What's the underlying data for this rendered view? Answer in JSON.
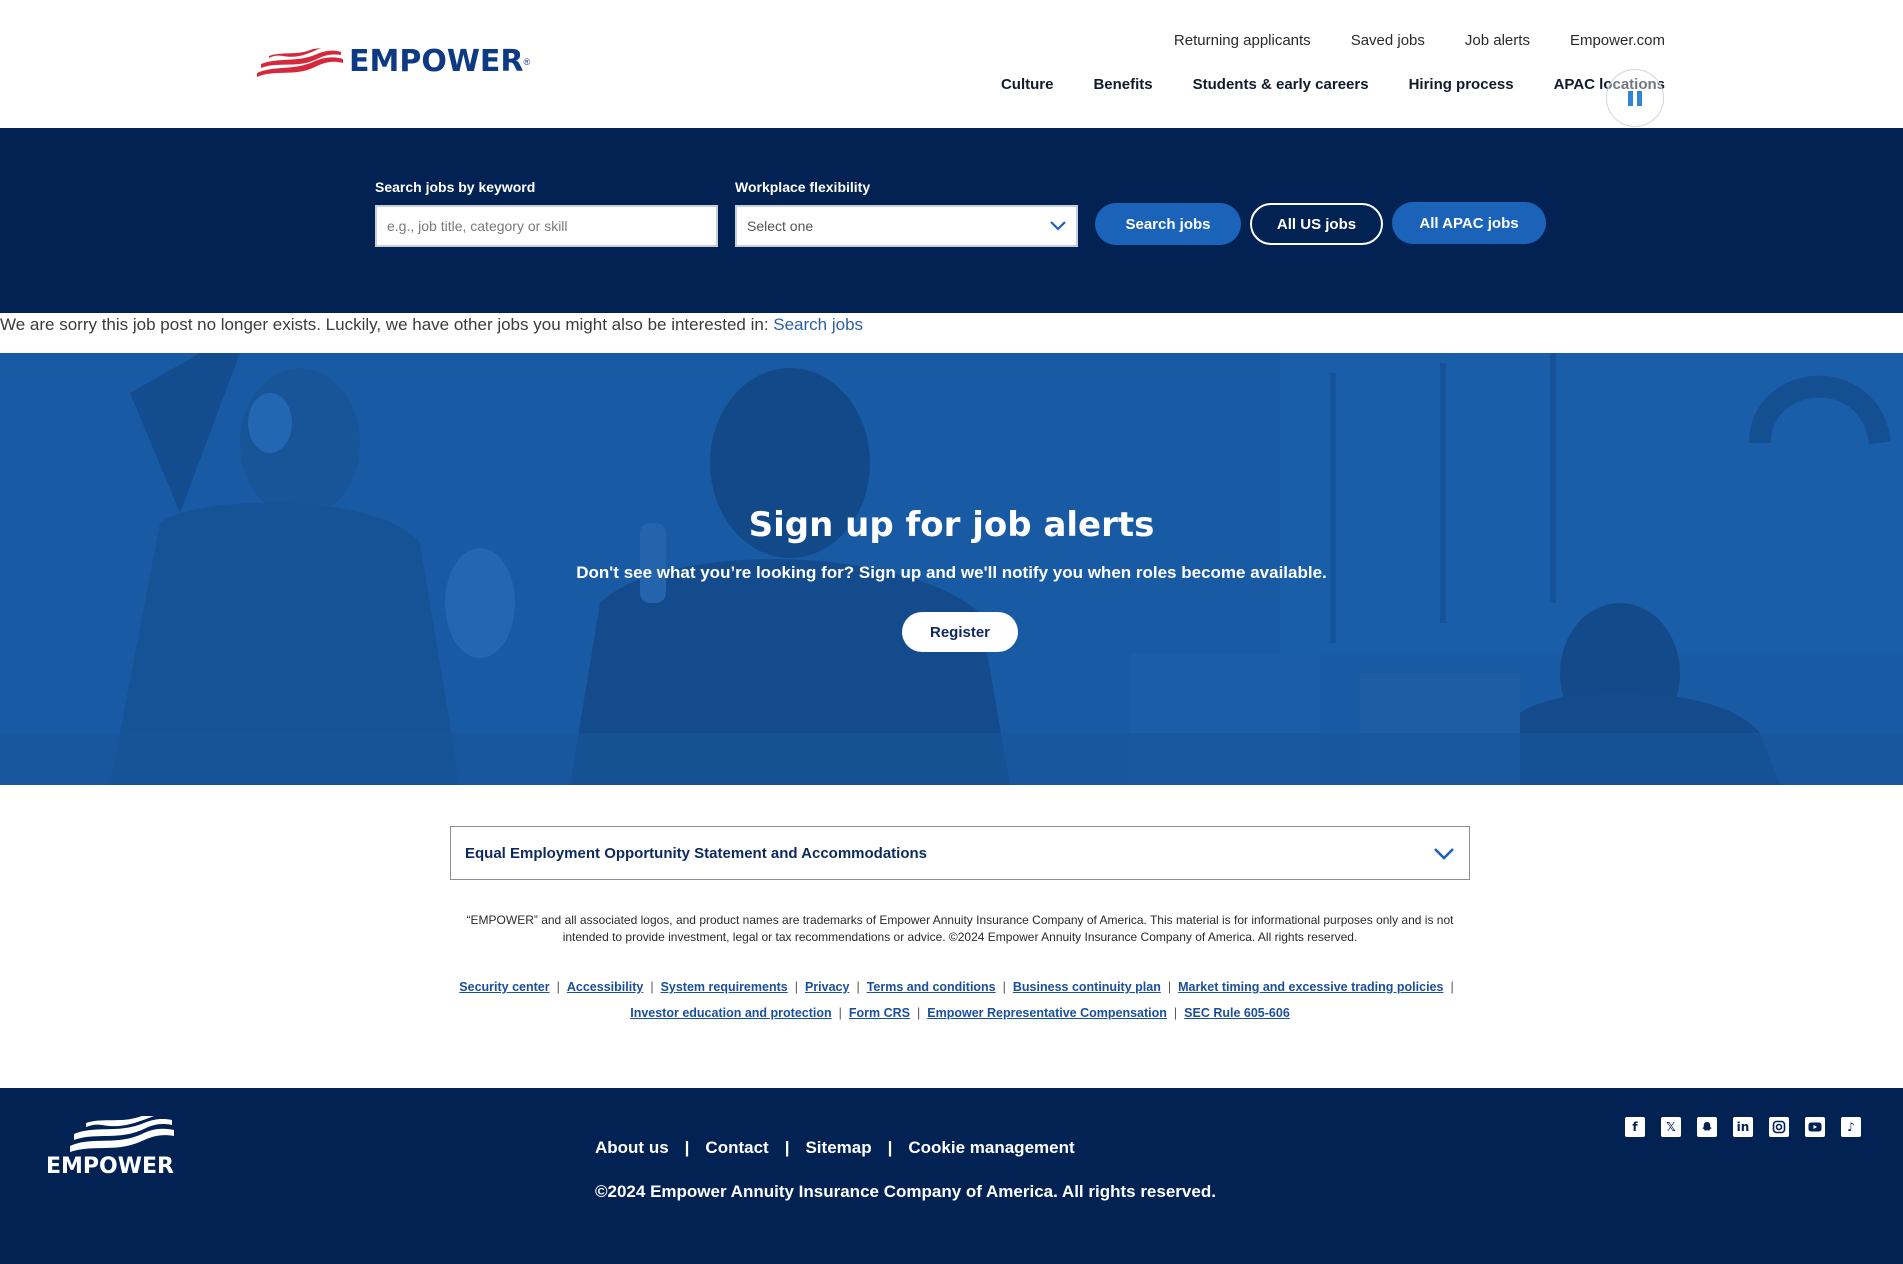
{
  "header": {
    "logo_text": "EMPOWER",
    "utility_nav": [
      "Returning applicants",
      "Saved jobs",
      "Job alerts",
      "Empower.com"
    ],
    "main_nav": [
      "Culture",
      "Benefits",
      "Students & early careers",
      "Hiring process",
      "APAC locations"
    ]
  },
  "search": {
    "keyword_label": "Search jobs by keyword",
    "keyword_placeholder": "e.g., job title, category or skill",
    "flex_label": "Workplace flexibility",
    "flex_value": "Select one",
    "search_button": "Search jobs",
    "us_button": "All US jobs",
    "apac_button": "All APAC jobs"
  },
  "notice": {
    "text": "We are sorry this job post no longer exists. Luckily, we have other jobs you might also be interested in: ",
    "link": "Search jobs"
  },
  "hero": {
    "title": "Sign up for job alerts",
    "subtitle": "Don't see what you’re looking for? Sign up and we'll notify you when roles become available.",
    "button": "Register"
  },
  "eeo": {
    "title": "Equal Employment Opportunity Statement and Accommodations"
  },
  "legal": {
    "text": "“EMPOWER” and all associated logos, and product names are trademarks of Empower Annuity Insurance Company of America. This material is for informational purposes only and is not intended to provide investment, legal or tax recommendations or advice. ©2024 Empower Annuity Insurance Company of America. All rights reserved.",
    "links_row1": [
      "Security center",
      "Accessibility",
      "System requirements",
      "Privacy",
      "Terms and conditions",
      "Business continuity plan",
      "Market timing and excessive trading policies"
    ],
    "links_row2": [
      "Investor education and protection",
      "Form CRS",
      "Empower Representative Compensation",
      "SEC Rule 605-606"
    ]
  },
  "footer": {
    "logo_text": "EMPOWER",
    "links": [
      "About us",
      "Contact",
      "Sitemap",
      "Cookie management"
    ],
    "copyright": "©2024 Empower Annuity Insurance Company of America. All rights reserved.",
    "social": [
      "facebook-icon",
      "x-icon",
      "snapchat-icon",
      "linkedin-icon",
      "instagram-icon",
      "youtube-icon",
      "tiktok-icon"
    ]
  },
  "colors": {
    "navy": "#032254",
    "brand_blue": "#0e3a84",
    "button_blue": "#1a63b9",
    "hero_blue": "#185aa6",
    "flag_red": "#d6283c"
  }
}
